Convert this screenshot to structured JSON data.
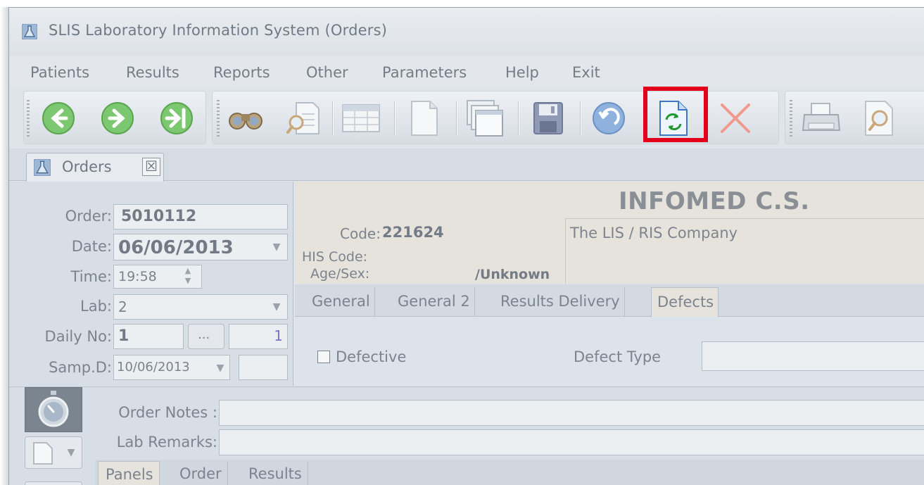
{
  "window": {
    "title": "SLIS Laboratory Information System (Orders)"
  },
  "menu": [
    "Patients",
    "Results",
    "Reports",
    "Other",
    "Parameters",
    "Help",
    "Exit"
  ],
  "toolbar": {
    "icons": [
      "back-arrow-icon",
      "forward-arrow-icon",
      "last-record-icon",
      "binoculars-icon",
      "search-document-icon",
      "table-grid-icon",
      "new-document-icon",
      "copy-documents-icon",
      "save-disk-icon",
      "undo-icon",
      "refresh-document-icon",
      "delete-x-icon",
      "printer-icon",
      "print-preview-icon"
    ],
    "highlighted": "refresh-document-icon",
    "colors": {
      "green": "#62b55a",
      "highlight": "#e4001b",
      "delete": "#f08b7f"
    }
  },
  "doc_tab": {
    "label": "Orders",
    "close_glyph": "☒"
  },
  "order": {
    "order_label": "Order:",
    "order_value": "5010112",
    "date_label": "Date:",
    "date_value": "06/06/2013",
    "time_label": "Time:",
    "time_value": "19:58",
    "lab_label": "Lab:",
    "lab_value": "2",
    "daily_label": "Daily No:",
    "daily_value": "1",
    "daily_button": "...",
    "daily_count": "1",
    "samp_label": "Samp.D:",
    "samp_value": "10/06/2013"
  },
  "patient": {
    "code_label": "Code:",
    "code_value": "221624",
    "his_label": "HIS Code:",
    "age_label": "Age/Sex:",
    "age_value": "/Unknown",
    "company": "INFOMED C.S.",
    "company_sub": "The LIS / RIS Company"
  },
  "sub_tabs": [
    "General",
    "General 2",
    "Results Delivery",
    "Defects"
  ],
  "defects": {
    "defective_label": "Defective",
    "type_label": "Defect Type"
  },
  "notes": {
    "order_notes_label": "Order Notes :",
    "lab_remarks_label": "Lab Remarks:"
  },
  "bottom_tabs": [
    "Panels",
    "Order",
    "Results"
  ]
}
